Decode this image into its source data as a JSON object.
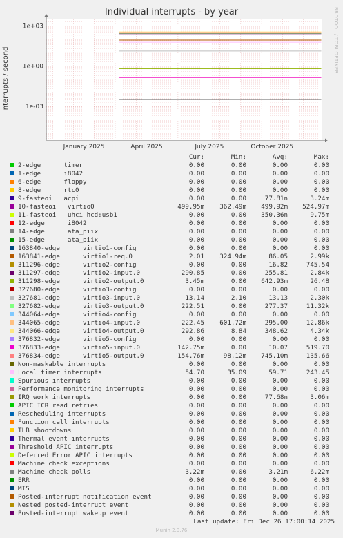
{
  "side_label": "RRDTOOL / TOBI OETIKER",
  "footer": {
    "last_update": "Last update: Fri Dec 26 17:00:14 2025",
    "version": "Munin 2.0.76"
  },
  "legend_header": {
    "cur": "Cur:",
    "min": "Min:",
    "avg": "Avg:",
    "max": "Max:"
  },
  "chart_data": {
    "type": "line",
    "title": "Individual interrupts - by year",
    "ylabel": "interrupts / second",
    "yscale": "log",
    "ylim": [
      3e-06,
      3000
    ],
    "y_ticks": [
      {
        "label": "1e+03",
        "value": 1000
      },
      {
        "label": "1e+00",
        "value": 1
      },
      {
        "label": "1e-03",
        "value": 0.001
      }
    ],
    "x_ticks": [
      {
        "label": "January 2025",
        "month": 1
      },
      {
        "label": "April 2025",
        "month": 4
      },
      {
        "label": "July 2025",
        "month": 7
      },
      {
        "label": "October 2025",
        "month": 10
      }
    ],
    "x_start_month": -0.3,
    "x_end_month": 12.9,
    "data_start_month": 3.2,
    "grid": true,
    "legend_placement": "below",
    "series": [
      {
        "name": "2-edge      timer",
        "color": "#00cc00",
        "cur": "0.00",
        "min": "0.00",
        "avg": "0.00",
        "max": "0.00",
        "level": 0
      },
      {
        "name": "1-edge      i8042",
        "color": "#0066b3",
        "cur": "0.00",
        "min": "0.00",
        "avg": "0.00",
        "max": "0.00",
        "level": 0
      },
      {
        "name": "6-edge      floppy",
        "color": "#ff8000",
        "cur": "0.00",
        "min": "0.00",
        "avg": "0.00",
        "max": "0.00",
        "level": 0
      },
      {
        "name": "8-edge      rtc0",
        "color": "#ffcc00",
        "cur": "0.00",
        "min": "0.00",
        "avg": "0.00",
        "max": "0.00",
        "level": 0
      },
      {
        "name": "9-fasteoi   acpi",
        "color": "#330099",
        "cur": "0.00",
        "min": "0.00",
        "avg": "77.81n",
        "max": "3.24m",
        "level": 0
      },
      {
        "name": "10-fasteoi   virtio0",
        "color": "#990099",
        "cur": "499.95m",
        "min": "362.49m",
        "avg": "499.92m",
        "max": "524.97m",
        "level": 0.5
      },
      {
        "name": "11-fasteoi   uhci_hcd:usb1",
        "color": "#ccff00",
        "cur": "0.00",
        "min": "0.00",
        "avg": "350.36n",
        "max": "9.75m",
        "level": 0
      },
      {
        "name": "12-edge      i8042",
        "color": "#ff0000",
        "cur": "0.00",
        "min": "0.00",
        "avg": "0.00",
        "max": "0.00",
        "level": 0
      },
      {
        "name": "14-edge      ata_piix",
        "color": "#808080",
        "cur": "0.00",
        "min": "0.00",
        "avg": "0.00",
        "max": "0.00",
        "level": 0
      },
      {
        "name": "15-edge      ata_piix",
        "color": "#008f00",
        "cur": "0.00",
        "min": "0.00",
        "avg": "0.00",
        "max": "0.00",
        "level": 0
      },
      {
        "name": "163840-edge      virtio1-config",
        "color": "#00487d",
        "cur": "0.00",
        "min": "0.00",
        "avg": "0.00",
        "max": "0.00",
        "level": 0
      },
      {
        "name": "163841-edge      virtio1-req.0",
        "color": "#b35a00",
        "cur": "2.01",
        "min": "324.94m",
        "avg": "86.05",
        "max": "2.99k",
        "level": 86.05
      },
      {
        "name": "311296-edge      virtio2-config",
        "color": "#b38f00",
        "cur": "0.00",
        "min": "0.00",
        "avg": "16.82",
        "max": "745.54",
        "level": 0
      },
      {
        "name": "311297-edge      virtio2-input.0",
        "color": "#6b006b",
        "cur": "290.85",
        "min": "0.00",
        "avg": "255.81",
        "max": "2.84k",
        "level": 255.81
      },
      {
        "name": "311298-edge      virtio2-output.0",
        "color": "#8fb300",
        "cur": "3.45m",
        "min": "0.00",
        "avg": "642.93m",
        "max": "26.48",
        "level": 0.64
      },
      {
        "name": "327680-edge      virtio3-config",
        "color": "#b30000",
        "cur": "0.00",
        "min": "0.00",
        "avg": "0.00",
        "max": "0.00",
        "level": 0
      },
      {
        "name": "327681-edge      virtio3-input.0",
        "color": "#bebebe",
        "cur": "13.14",
        "min": "2.10",
        "avg": "13.13",
        "max": "2.30k",
        "level": 13.13
      },
      {
        "name": "327682-edge      virtio3-output.0",
        "color": "#80ff80",
        "cur": "222.51",
        "min": "0.00",
        "avg": "277.37",
        "max": "11.32k",
        "level": 277.37
      },
      {
        "name": "344064-edge      virtio4-config",
        "color": "#80c9ff",
        "cur": "0.00",
        "min": "0.00",
        "avg": "0.00",
        "max": "0.00",
        "level": 0
      },
      {
        "name": "344065-edge      virtio4-input.0",
        "color": "#ffc080",
        "cur": "222.45",
        "min": "601.72m",
        "avg": "295.00",
        "max": "12.86k",
        "level": 295
      },
      {
        "name": "344066-edge      virtio4-output.0",
        "color": "#ffe680",
        "cur": "292.86",
        "min": "8.84",
        "avg": "348.62",
        "max": "4.34k",
        "level": 348.62
      },
      {
        "name": "376832-edge      virtio5-config",
        "color": "#aa80ff",
        "cur": "0.00",
        "min": "0.00",
        "avg": "0.00",
        "max": "0.00",
        "level": 0
      },
      {
        "name": "376833-edge      virtio5-input.0",
        "color": "#ee00cc",
        "cur": "142.75m",
        "min": "0.00",
        "avg": "10.07",
        "max": "519.70",
        "level": 0.14
      },
      {
        "name": "376834-edge      virtio5-output.0",
        "color": "#ff8080",
        "cur": "154.76m",
        "min": "98.12m",
        "avg": "745.10m",
        "max": "135.66",
        "level": 0.15
      },
      {
        "name": "Non-maskable interrupts",
        "color": "#666600",
        "cur": "0.00",
        "min": "0.00",
        "avg": "0.00",
        "max": "0.00",
        "level": 0
      },
      {
        "name": "Local timer interrupts",
        "color": "#ffbfff",
        "cur": "54.70",
        "min": "35.09",
        "avg": "59.71",
        "max": "243.45",
        "level": 59.71
      },
      {
        "name": "Spurious interrupts",
        "color": "#00ffcc",
        "cur": "0.00",
        "min": "0.00",
        "avg": "0.00",
        "max": "0.00",
        "level": 0
      },
      {
        "name": "Performance monitoring interrupts",
        "color": "#cc6699",
        "cur": "0.00",
        "min": "0.00",
        "avg": "0.00",
        "max": "0.00",
        "level": 0
      },
      {
        "name": "IRQ work interrupts",
        "color": "#999900",
        "cur": "0.00",
        "min": "0.00",
        "avg": "77.68n",
        "max": "3.06m",
        "level": 0
      },
      {
        "name": "APIC ICR read retries",
        "color": "#00cc00",
        "cur": "0.00",
        "min": "0.00",
        "avg": "0.00",
        "max": "0.00",
        "level": 0
      },
      {
        "name": "Rescheduling interrupts",
        "color": "#0066b3",
        "cur": "0.00",
        "min": "0.00",
        "avg": "0.00",
        "max": "0.00",
        "level": 0
      },
      {
        "name": "Function call interrupts",
        "color": "#ff8000",
        "cur": "0.00",
        "min": "0.00",
        "avg": "0.00",
        "max": "0.00",
        "level": 0
      },
      {
        "name": "TLB shootdowns",
        "color": "#ffcc00",
        "cur": "0.00",
        "min": "0.00",
        "avg": "0.00",
        "max": "0.00",
        "level": 0
      },
      {
        "name": "Thermal event interrupts",
        "color": "#330099",
        "cur": "0.00",
        "min": "0.00",
        "avg": "0.00",
        "max": "0.00",
        "level": 0
      },
      {
        "name": "Threshold APIC interrupts",
        "color": "#990099",
        "cur": "0.00",
        "min": "0.00",
        "avg": "0.00",
        "max": "0.00",
        "level": 0
      },
      {
        "name": "Deferred Error APIC interrupts",
        "color": "#ccff00",
        "cur": "0.00",
        "min": "0.00",
        "avg": "0.00",
        "max": "0.00",
        "level": 0
      },
      {
        "name": "Machine check exceptions",
        "color": "#ff0000",
        "cur": "0.00",
        "min": "0.00",
        "avg": "0.00",
        "max": "0.00",
        "level": 0
      },
      {
        "name": "Machine check polls",
        "color": "#808080",
        "cur": "3.22m",
        "min": "0.00",
        "avg": "3.21m",
        "max": "6.22m",
        "level": 0.0032
      },
      {
        "name": "ERR",
        "color": "#008f00",
        "cur": "0.00",
        "min": "0.00",
        "avg": "0.00",
        "max": "0.00",
        "level": 0
      },
      {
        "name": "MIS",
        "color": "#00487d",
        "cur": "0.00",
        "min": "0.00",
        "avg": "0.00",
        "max": "0.00",
        "level": 0
      },
      {
        "name": "Posted-interrupt notification event",
        "color": "#b35a00",
        "cur": "0.00",
        "min": "0.00",
        "avg": "0.00",
        "max": "0.00",
        "level": 0
      },
      {
        "name": "Nested posted-interrupt event",
        "color": "#b38f00",
        "cur": "0.00",
        "min": "0.00",
        "avg": "0.00",
        "max": "0.00",
        "level": 0
      },
      {
        "name": "Posted-interrupt wakeup event",
        "color": "#6b006b",
        "cur": "0.00",
        "min": "0.00",
        "avg": "0.00",
        "max": "0.00",
        "level": 0
      }
    ]
  }
}
